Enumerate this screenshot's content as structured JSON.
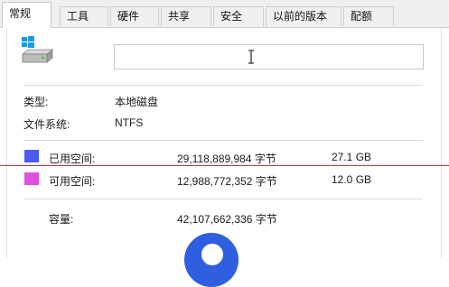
{
  "tabs": [
    {
      "label": "常规",
      "active": true
    },
    {
      "label": "工具",
      "active": false
    },
    {
      "label": "硬件",
      "active": false
    },
    {
      "label": "共享",
      "active": false
    },
    {
      "label": "安全",
      "active": false
    },
    {
      "label": "以前的版本",
      "active": false
    },
    {
      "label": "配额",
      "active": false
    }
  ],
  "drive": {
    "icon": "drive-icon",
    "name_value": ""
  },
  "type": {
    "label": "类型:",
    "value": "本地磁盘"
  },
  "filesystem": {
    "label": "文件系统:",
    "value": "NTFS"
  },
  "used": {
    "label": "已用空间:",
    "bytes": "29,118,889,984 字节",
    "size": "27.1 GB",
    "color": "#4a5cf0"
  },
  "free": {
    "label": "可用空间:",
    "bytes": "12,988,772,352 字节",
    "size": "12.0 GB",
    "color": "#e04fe0"
  },
  "capacity": {
    "label": "容量:",
    "bytes": "42,107,662,336 字节"
  },
  "colors": {
    "annotation_line": "#c8373a",
    "circle": "#2f5fe0"
  }
}
